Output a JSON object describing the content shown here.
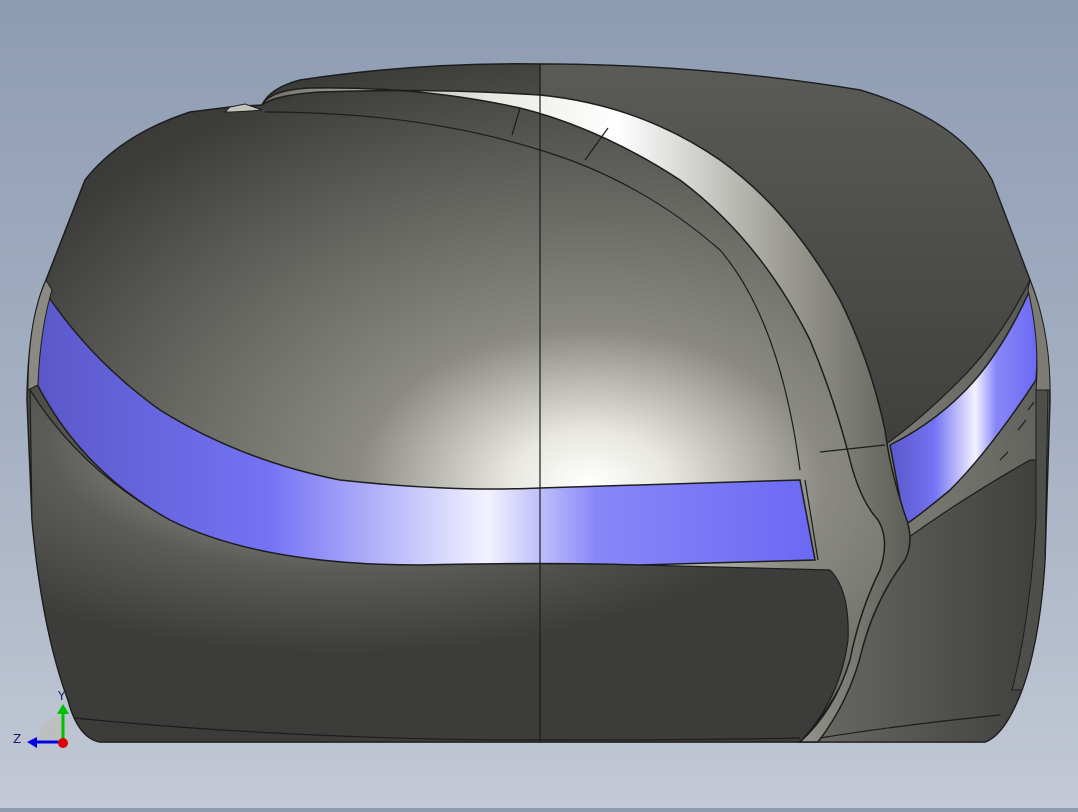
{
  "viewport": {
    "background_top": "#8e9cb3",
    "background_bottom": "#c3c9d5"
  },
  "model": {
    "body_color": "#5d5e59",
    "band_color": "#6d6cf5",
    "trim_color": "#a8a89e",
    "edge_color": "#1d1d1d"
  },
  "triad": {
    "x_axis_color": "#e00000",
    "y_axis_color": "#00c000",
    "z_axis_color": "#0000e0",
    "labels": {
      "y": "Y",
      "z": "Z"
    }
  }
}
